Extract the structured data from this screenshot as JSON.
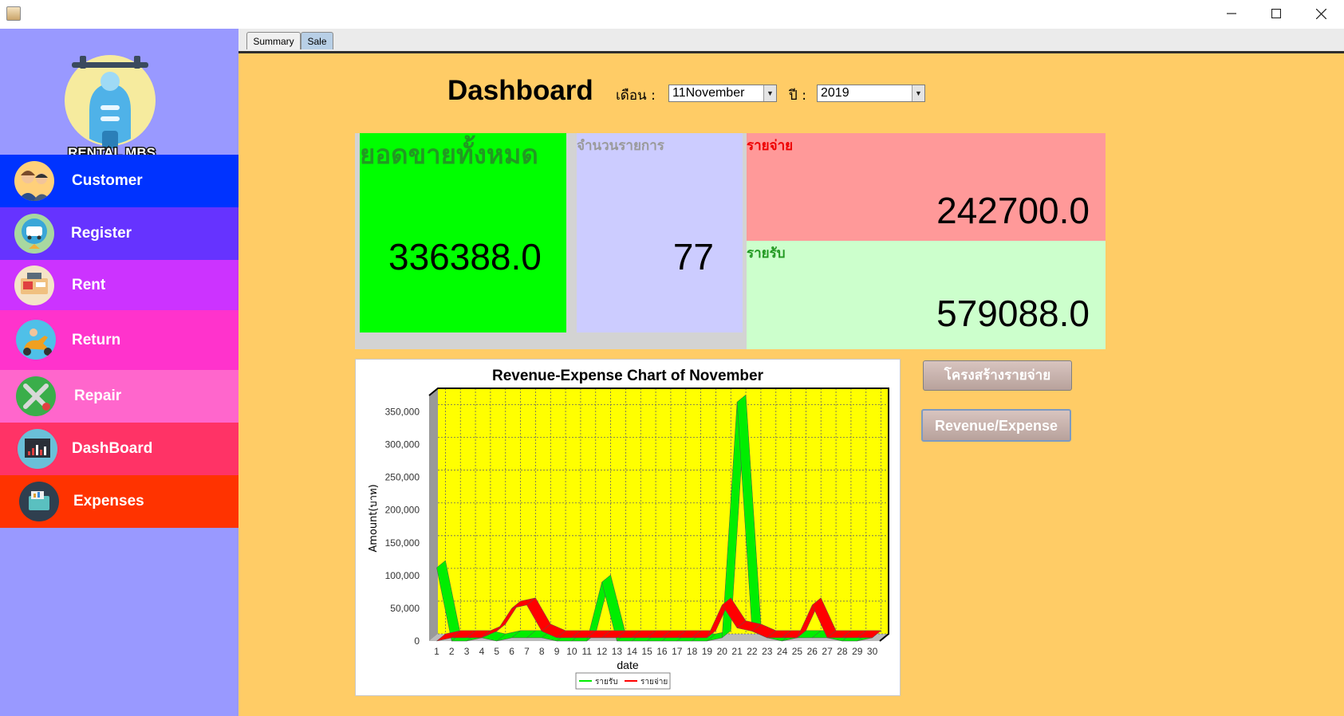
{
  "sidebar": {
    "logo_text": "RENTAL MBS",
    "items": [
      {
        "label": "Customer",
        "icon": "customer-icon",
        "color": "#0033ff"
      },
      {
        "label": "Register",
        "icon": "register-icon",
        "color": "#6633ff"
      },
      {
        "label": "Rent",
        "icon": "rent-icon",
        "color": "#cc33ff"
      },
      {
        "label": "Return",
        "icon": "return-icon",
        "color": "#ff33cc"
      },
      {
        "label": "Repair",
        "icon": "repair-icon",
        "color": "#ff66cc"
      },
      {
        "label": "DashBoard",
        "icon": "dashboard-icon",
        "color": "#ff3366"
      },
      {
        "label": "Expenses",
        "icon": "expenses-icon",
        "color": "#ff3300"
      }
    ]
  },
  "tabs": [
    {
      "label": "Summary"
    },
    {
      "label": "Sale"
    }
  ],
  "header": {
    "title": "Dashboard",
    "month_label": "เดือน :",
    "month_value": "11November",
    "year_label": "ปี :",
    "year_value": "2019"
  },
  "stats": {
    "total_sales": {
      "label": "ยอดขายทั้งหมด",
      "value": "336388.0",
      "color": "#00ff00"
    },
    "item_count": {
      "label": "จำนวนรายการ",
      "value": "77",
      "color": "#ccccff"
    },
    "expense": {
      "label": "รายจ่าย",
      "value": "242700.0",
      "color": "#ff9999"
    },
    "income": {
      "label": "รายรับ",
      "value": "579088.0",
      "color": "#ccffcc"
    }
  },
  "buttons": {
    "expense_structure": "โครงสร้างรายจ่าย",
    "revenue_expense": "Revenue/Expense"
  },
  "chart_data": {
    "type": "area",
    "title": "Revenue-Expense Chart of November",
    "xlabel": "date",
    "ylabel": "Amount(บาท)",
    "x": [
      "1",
      "2",
      "3",
      "4",
      "5",
      "6",
      "7",
      "8",
      "9",
      "10",
      "11",
      "12",
      "13",
      "14",
      "15",
      "16",
      "17",
      "18",
      "19",
      "20",
      "21",
      "22",
      "23",
      "24",
      "25",
      "26",
      "27",
      "28",
      "29",
      "30"
    ],
    "ylim": [
      0,
      375000
    ],
    "yticks": [
      0,
      50000,
      100000,
      150000,
      200000,
      250000,
      300000,
      350000
    ],
    "ytick_labels": [
      "0",
      "50,000",
      "100,000",
      "150,000",
      "200,000",
      "250,000",
      "300,000",
      "350,000"
    ],
    "grid": true,
    "legend": "bottom-center",
    "series": [
      {
        "name": "รายรับ",
        "color": "#00ee00",
        "values": [
          112000,
          0,
          0,
          5000,
          0,
          5000,
          5000,
          5000,
          0,
          0,
          0,
          90000,
          0,
          0,
          0,
          0,
          0,
          0,
          0,
          5000,
          365000,
          15000,
          5000,
          0,
          5000,
          5000,
          5000,
          0,
          0,
          5000
        ]
      },
      {
        "name": "รายจ่าย",
        "color": "#ff0000",
        "values": [
          0,
          5000,
          5000,
          5000,
          15000,
          50000,
          55000,
          15000,
          5000,
          5000,
          5000,
          5000,
          5000,
          5000,
          5000,
          5000,
          5000,
          5000,
          5000,
          55000,
          20000,
          15000,
          5000,
          5000,
          5000,
          55000,
          5000,
          5000,
          5000,
          5000
        ]
      }
    ]
  }
}
